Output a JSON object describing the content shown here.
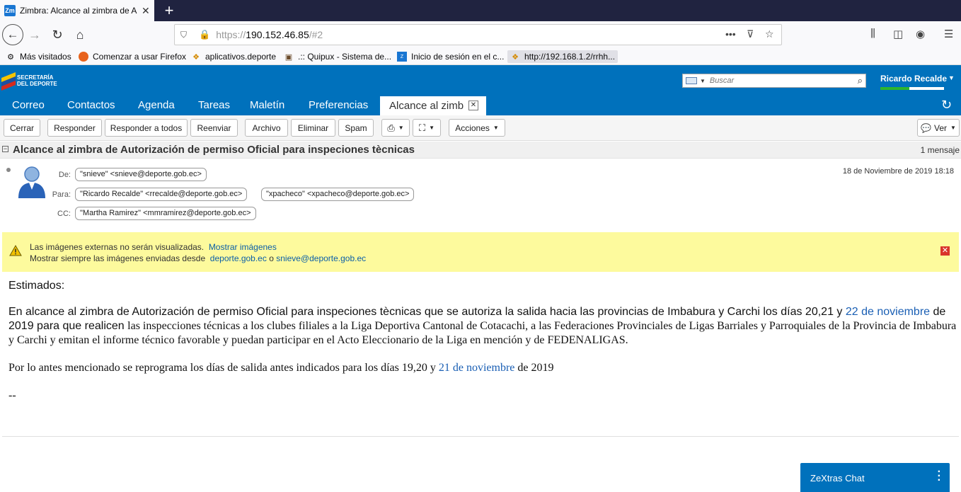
{
  "browser": {
    "tab_title": "Zimbra: Alcance al zimbra de A",
    "tab_favicon": "Zm",
    "url_scheme": "https://",
    "url_host": "190.152.46.85",
    "url_path": "/#2",
    "bookmarks": [
      {
        "label": "Más visitados",
        "icon": "gear-icon"
      },
      {
        "label": "Comenzar a usar Firefox",
        "icon": "firefox-icon"
      },
      {
        "label": "aplicativos.deporte",
        "icon": "bookmark-icon"
      },
      {
        "label": ".:: Quipux - Sistema de...",
        "icon": "quipux-icon"
      },
      {
        "label": "Inicio de sesión en el c...",
        "icon": "zimbra-icon"
      },
      {
        "label": "http://192.168.1.2/rrhh...",
        "icon": "bookmark-icon"
      }
    ]
  },
  "zimbra": {
    "logo_line1": "SECRETARÍA",
    "logo_line2": "DEL DEPORTE",
    "search_placeholder": "Buscar",
    "user_name": "Ricardo Recalde",
    "quota_fraction": 0.45,
    "app_tabs": [
      "Correo",
      "Contactos",
      "Agenda",
      "Tareas",
      "Maletín",
      "Preferencias"
    ],
    "active_tab": "Alcance al zimb",
    "toolbar": {
      "cerrar": "Cerrar",
      "responder": "Responder",
      "responder_todos": "Responder a todos",
      "reenviar": "Reenviar",
      "archivo": "Archivo",
      "eliminar": "Eliminar",
      "spam": "Spam",
      "acciones": "Acciones",
      "ver": "Ver"
    }
  },
  "conversation": {
    "subject": "Alcance al zimbra de Autorización de permiso Oficial para inspeciones tècnicas",
    "count": "1 mensaje"
  },
  "message": {
    "from_label": "De:",
    "to_label": "Para:",
    "cc_label": "CC:",
    "from": "\"snieve\" <snieve@deporte.gob.ec>",
    "to": [
      "\"Ricardo Recalde\" <rrecalde@deporte.gob.ec>",
      "\"xpacheco\" <xpacheco@deporte.gob.ec>"
    ],
    "cc": "\"Martha Ramirez\" <mmramirez@deporte.gob.ec>",
    "date": "18 de Noviembre de 2019 18:18"
  },
  "warning": {
    "line1": "Las imágenes externas no serán visualizadas.",
    "show_images": "Mostrar imágenes",
    "line2": "Mostrar siempre las imágenes enviadas desde",
    "domain_link": "deporte.gob.ec",
    "or": "o",
    "sender_link": "snieve@deporte.gob.ec"
  },
  "body": {
    "greeting": "Estimados:",
    "p1_a": "En alcance al zimbra de Autorización de permiso Oficial para inspeciones tècnicas que se autoriza la salida hacia las provincias de Imbabura y Carchi los días 20,21 y",
    "p1_date": "22 de noviembre",
    "p1_b": "de 2019 para que realicen",
    "p1_c": "las inspecciones técnicas a los clubes filiales a la Liga Deportiva Cantonal de Cotacachi,  a las Federaciones Provinciales de Ligas Barriales y Parroquiales de la Provincia de Imbabura y Carchi y emitan  el informe técnico favorable y puedan participar en el Acto Eleccionario de la Liga en mención y de FEDENALIGAS.",
    "p2_a": "Por lo antes mencionado se reprograma los días de salida antes indicados para los días 19,20 y",
    "p2_date": "21 de noviembre",
    "p2_b": "de 2019",
    "signature": "--"
  },
  "chat": {
    "title": "ZeXtras Chat"
  }
}
